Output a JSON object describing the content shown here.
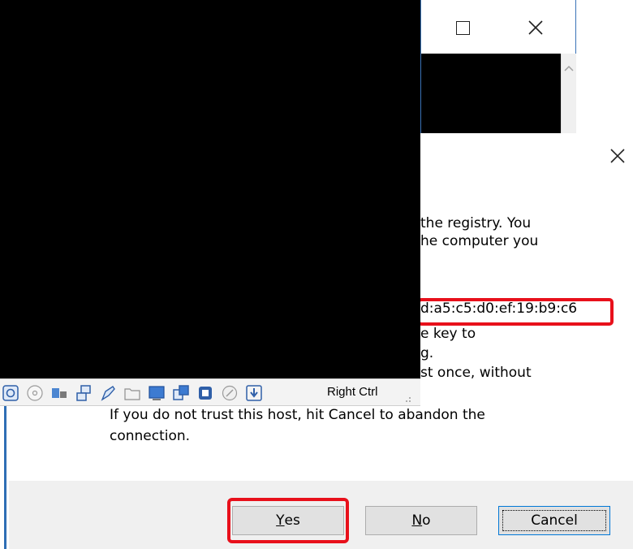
{
  "terminal_window": {
    "maximize_icon": "maximize-icon",
    "close_icon": "close-icon",
    "scroll_up_icon": "scroll-up-arrow-icon"
  },
  "dialog": {
    "close_icon": "close-icon",
    "lines_right": [
      "the registry. You",
      "he computer you",
      "d:a5:c5:d0:ef:19:b9:c6",
      "e key to",
      "g.",
      "st once, without"
    ],
    "lines_full": [
      "If you do not trust this host, hit Cancel to abandon the",
      "connection."
    ],
    "buttons": {
      "yes": {
        "mnemonic": "Y",
        "rest": "es"
      },
      "no": {
        "mnemonic": "N",
        "rest": "o"
      },
      "cancel": "Cancel"
    },
    "highlight_color": "#e8101b",
    "border_color": "#2f6fb5"
  },
  "vbox": {
    "host_key_label": "Right Ctrl",
    "status_icons": [
      "network-icon",
      "optical-drive-icon",
      "audio-icon",
      "shared-network-icon",
      "usb-icon",
      "shared-folders-icon",
      "display-icon",
      "video-capture-icon",
      "cpu-icon",
      "mouse-integration-icon",
      "arrow-down-icon"
    ]
  }
}
